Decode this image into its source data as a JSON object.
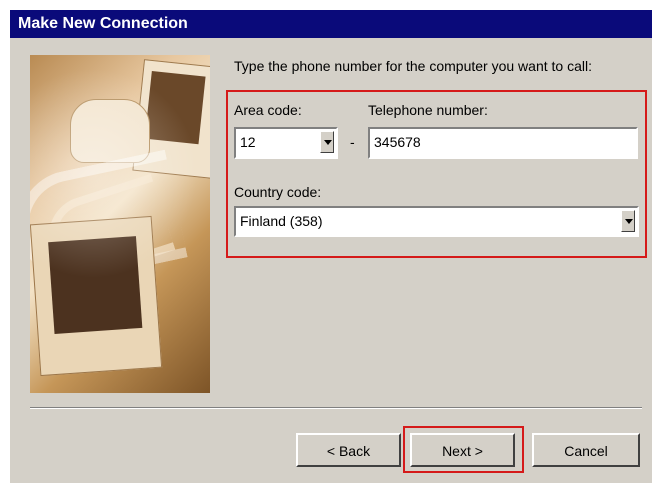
{
  "window": {
    "title": "Make New Connection"
  },
  "dialog": {
    "prompt": "Type the phone number for the computer you want to call:",
    "area_code_label": "Area code:",
    "telephone_label": "Telephone number:",
    "country_code_label": "Country code:",
    "area_code_value": "12",
    "telephone_value": "345678",
    "country_code_value": "Finland (358)",
    "separator_text": "-"
  },
  "buttons": {
    "back": "< Back",
    "next": "Next >",
    "cancel": "Cancel"
  },
  "icons": {
    "dropdown": "chevron-down-icon",
    "illustration": "connection-illustration"
  },
  "colors": {
    "title_bar": "#0A0A7A",
    "highlight": "#D51A1A",
    "dialog_face": "#D4D0C8"
  }
}
